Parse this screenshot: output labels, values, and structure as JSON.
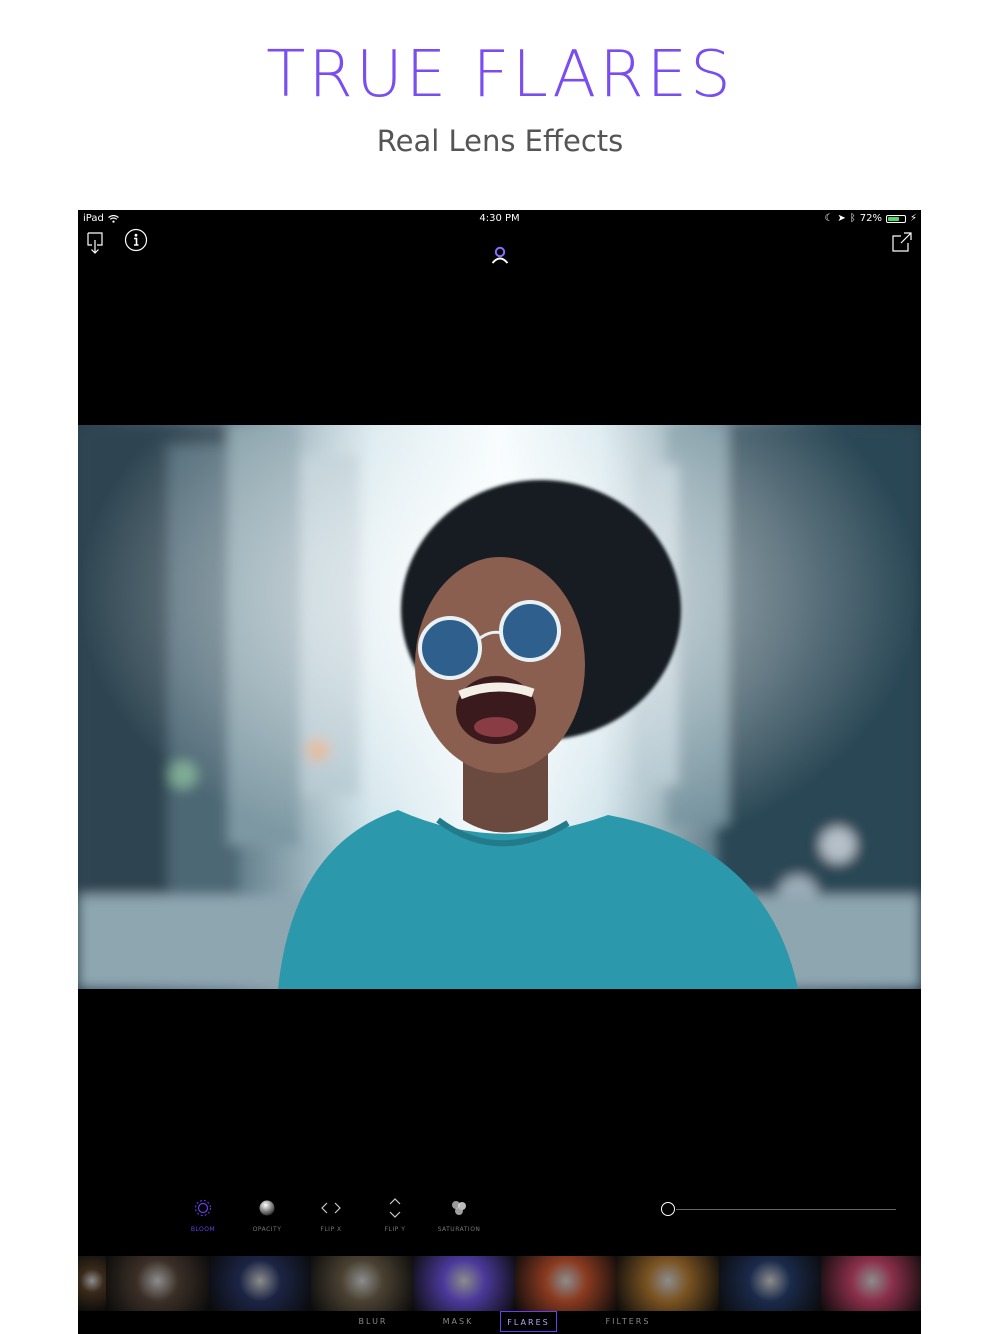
{
  "header": {
    "title": "TRUE FLARES",
    "subtitle": "Real Lens Effects"
  },
  "status_bar": {
    "device": "iPad",
    "time": "4:30 PM",
    "battery_percent": "72%",
    "battery_level": 0.72
  },
  "toolbar": {
    "import_icon": "import-icon",
    "info_icon": "info-icon",
    "profile_icon": "person-icon",
    "share_icon": "share-icon"
  },
  "adjustments": [
    {
      "label": "BLOOM",
      "icon": "sun-icon",
      "active": true
    },
    {
      "label": "OPACITY",
      "icon": "sphere-icon",
      "active": false
    },
    {
      "label": "FLIP X",
      "icon": "flip-x-icon",
      "active": false
    },
    {
      "label": "FLIP Y",
      "icon": "flip-y-icon",
      "active": false
    },
    {
      "label": "SATURATION",
      "icon": "circles-icon",
      "active": false
    }
  ],
  "slider": {
    "value": 0
  },
  "flare_presets": [
    {
      "name": "preset-1",
      "color": "#3a2a1a"
    },
    {
      "name": "preset-2",
      "color": "#3b2f27"
    },
    {
      "name": "preset-3",
      "color": "#1b2444"
    },
    {
      "name": "preset-4",
      "color": "#4a4132"
    },
    {
      "name": "preset-5",
      "color": "#4b3a9a"
    },
    {
      "name": "preset-6",
      "color": "#8a3a20"
    },
    {
      "name": "preset-7",
      "color": "#7a5322"
    },
    {
      "name": "preset-8",
      "color": "#1a2a4a"
    },
    {
      "name": "preset-9",
      "color": "#8a2f4a"
    }
  ],
  "tabs": [
    {
      "label": "BLUR",
      "active": false
    },
    {
      "label": "MASK",
      "active": false
    },
    {
      "label": "FLARES",
      "active": true
    },
    {
      "label": "FILTERS",
      "active": false
    }
  ],
  "colors": {
    "accent": "#6a3df0",
    "title": "#7a4df0"
  }
}
